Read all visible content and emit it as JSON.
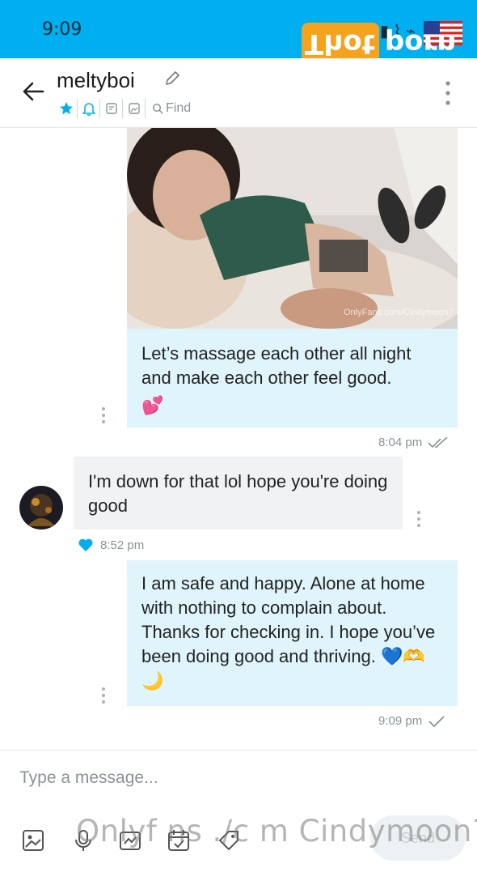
{
  "status_bar": {
    "time": "9:09",
    "icons": "▮ ⌇ ⌁"
  },
  "watermark_top": {
    "text": "Thot porn"
  },
  "header": {
    "username": "meltyboi",
    "find_label": "Find",
    "icons": [
      "star-icon",
      "bell-icon",
      "note-icon",
      "image-icon",
      "search-icon"
    ]
  },
  "messages": [
    {
      "direction": "outgoing",
      "has_photo": true,
      "photo_watermark": "OnlyFans.com/Cindymoon7",
      "text": "Let’s massage each other all night and make each other feel good.",
      "emoji": "💕",
      "time": "8:04 pm",
      "receipt": "double-check-icon"
    },
    {
      "direction": "incoming",
      "text": "I'm down for that lol hope you're doing good",
      "liked": true,
      "time": "8:52 pm"
    },
    {
      "direction": "outgoing",
      "text": "I am safe and happy. Alone at home with nothing to complain about. Thanks for checking in. I hope you’ve been doing good and thriving.",
      "emoji": "💙🫶🌙",
      "time": "9:09 pm",
      "receipt": "check-icon"
    }
  ],
  "composer": {
    "placeholder": "Type a message...",
    "send_label": "Send",
    "tools": [
      "image-icon",
      "microphone-icon",
      "vault-icon",
      "schedule-icon",
      "price-tag-icon"
    ]
  },
  "watermark_bottom": {
    "text": "Onlyf ns ./c m Cindymoon7"
  },
  "colors": {
    "brand": "#00aff0",
    "outgoing_bubble": "#dff4fb",
    "incoming_bubble": "#f0f2f4",
    "accent": "#00aff0"
  }
}
